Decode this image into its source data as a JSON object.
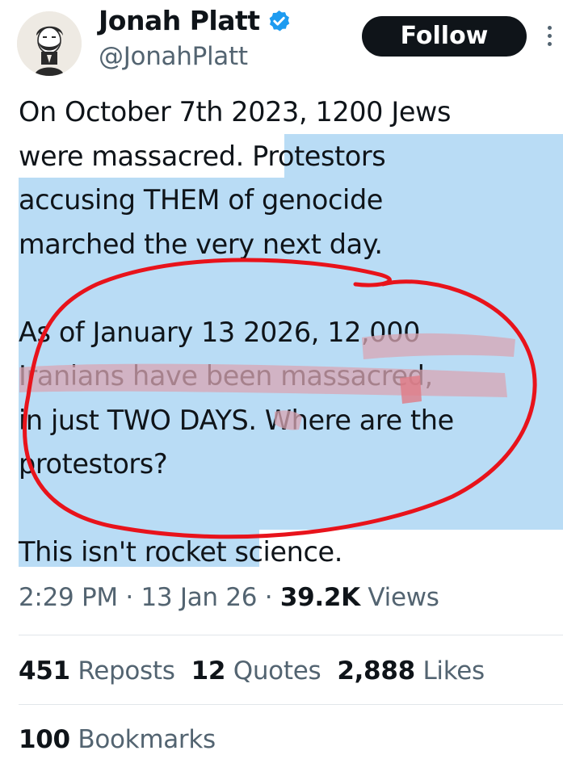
{
  "author": {
    "display_name": "Jonah Platt",
    "handle": "@JonahPlatt",
    "verified": true,
    "verified_color": "#1d9bf0",
    "avatar_icon": "bearded-man-portrait-avatar"
  },
  "header": {
    "follow_label": "Follow",
    "more_icon": "more-vertical-icon"
  },
  "tweet": {
    "lines": [
      "On October 7th 2023, 1200 Jews",
      "were massacred. Protestors",
      "accusing THEM of genocide",
      "marched the very next day.",
      "",
      "As of January 13 2026, 12,000",
      "Iranians have been massacred,",
      "in just TWO DAYS. Where are the",
      "protestors?",
      "",
      "This isn't rocket science."
    ],
    "highlight_color": "#b9dcf5",
    "annotation_color": "#e8131b"
  },
  "meta": {
    "time": "2:29 PM",
    "separator": " · ",
    "date": "13 Jan 26",
    "views_count": "39.2K",
    "views_label": "Views"
  },
  "stats": {
    "reposts_count": "451",
    "reposts_label": "Reposts",
    "quotes_count": "12",
    "quotes_label": "Quotes",
    "likes_count": "2,888",
    "likes_label": "Likes",
    "bookmarks_count": "100",
    "bookmarks_label": "Bookmarks"
  }
}
